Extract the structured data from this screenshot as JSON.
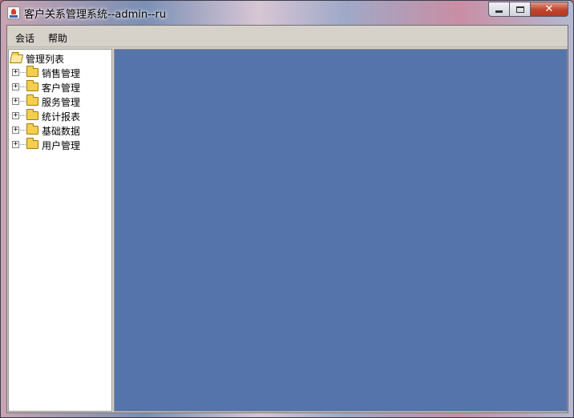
{
  "window": {
    "title": "客户关系管理系统--admin--ru",
    "controls": {
      "minimize": "minimize",
      "maximize": "maximize",
      "close": "✕"
    }
  },
  "menubar": {
    "items": [
      {
        "label": "会话"
      },
      {
        "label": "帮助"
      }
    ]
  },
  "tree": {
    "root": {
      "label": "管理列表",
      "icon": "folder-open-icon"
    },
    "nodes": [
      {
        "label": "销售管理",
        "expander": "+",
        "icon": "folder-icon"
      },
      {
        "label": "客户管理",
        "expander": "+",
        "icon": "folder-icon"
      },
      {
        "label": "服务管理",
        "expander": "+",
        "icon": "folder-icon"
      },
      {
        "label": "统计报表",
        "expander": "+",
        "icon": "folder-icon"
      },
      {
        "label": "基础数据",
        "expander": "+",
        "icon": "folder-icon"
      },
      {
        "label": "用户管理",
        "expander": "+",
        "icon": "folder-icon"
      }
    ]
  },
  "colors": {
    "content_background": "#5574ab",
    "close_button": "#c1432b",
    "folder": "#f4cf4e"
  }
}
